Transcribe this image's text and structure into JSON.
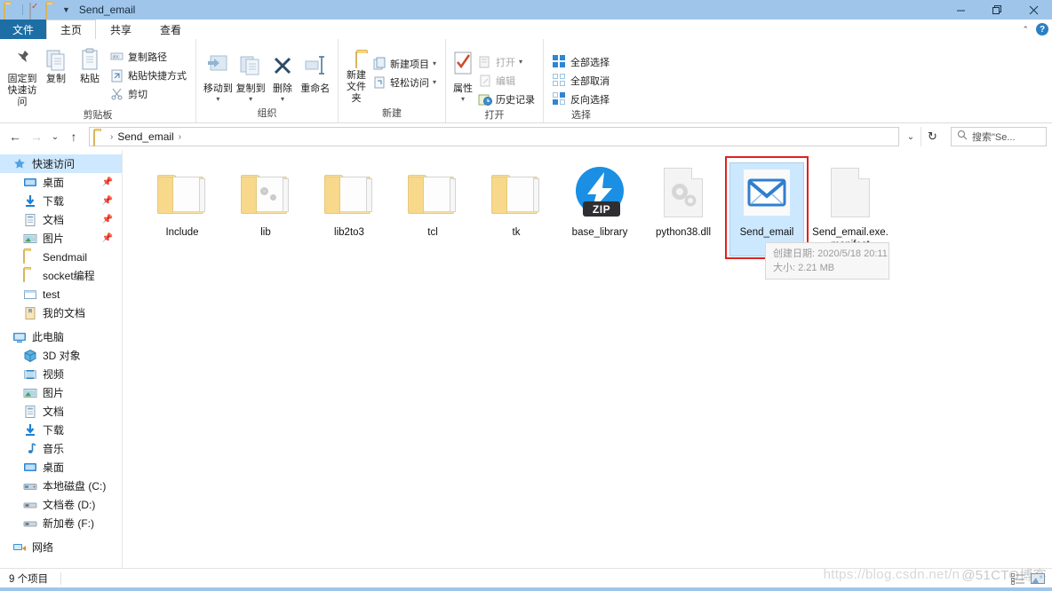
{
  "window": {
    "title": "Send_email",
    "quick_access": [
      "folder-icon",
      "properties-icon",
      "folder-icon",
      "dropdown-icon"
    ],
    "controls": {
      "minimize": "—",
      "maximize": "❐",
      "close": "✕"
    }
  },
  "menubar": {
    "file_tab": "文件",
    "tabs": [
      {
        "label": "主页",
        "active": true
      },
      {
        "label": "共享",
        "active": false
      },
      {
        "label": "查看",
        "active": false
      }
    ],
    "collapse": "⌃",
    "help": "?"
  },
  "ribbon": {
    "groups": [
      {
        "title": "剪贴板",
        "big_buttons": [
          {
            "label": "固定到快速访问",
            "icon": "pin-icon"
          },
          {
            "label": "复制",
            "icon": "copy-icon"
          },
          {
            "label": "粘贴",
            "icon": "paste-icon"
          }
        ],
        "small_buttons": [
          {
            "label": "复制路径",
            "icon": "copy-path-icon"
          },
          {
            "label": "粘贴快捷方式",
            "icon": "paste-shortcut-icon"
          },
          {
            "label": "剪切",
            "icon": "scissors-icon"
          }
        ]
      },
      {
        "title": "组织",
        "big_buttons": [
          {
            "label": "移动到",
            "icon": "move-to-icon"
          },
          {
            "label": "复制到",
            "icon": "copy-to-icon"
          },
          {
            "label": "删除",
            "icon": "delete-x-icon"
          },
          {
            "label": "重命名",
            "icon": "rename-icon"
          }
        ]
      },
      {
        "title": "新建",
        "big_buttons": [
          {
            "label": "新建文件夹",
            "icon": "new-folder-icon"
          }
        ],
        "small_buttons": [
          {
            "label": "新建项目",
            "icon": "new-item-icon"
          },
          {
            "label": "轻松访问",
            "icon": "easy-access-icon"
          }
        ]
      },
      {
        "title": "打开",
        "big_buttons": [
          {
            "label": "属性",
            "icon": "properties-icon"
          }
        ],
        "small_buttons": [
          {
            "label": "打开",
            "icon": "open-icon"
          },
          {
            "label": "编辑",
            "icon": "edit-icon"
          },
          {
            "label": "历史记录",
            "icon": "history-icon"
          }
        ]
      },
      {
        "title": "选择",
        "small_buttons": [
          {
            "label": "全部选择",
            "icon": "select-all-icon"
          },
          {
            "label": "全部取消",
            "icon": "select-none-icon"
          },
          {
            "label": "反向选择",
            "icon": "invert-selection-icon"
          }
        ]
      }
    ]
  },
  "addressbar": {
    "back": "←",
    "forward": "→",
    "history": "⌄",
    "up": "↑",
    "breadcrumbs": [
      "Send_email"
    ],
    "dropdown": "⌄",
    "refresh": "↻",
    "search_placeholder": "搜索\"Se..."
  },
  "sidebar": {
    "groups": [
      {
        "header": {
          "label": "快速访问",
          "icon": "star-pin-icon",
          "selected": true
        },
        "items": [
          {
            "label": "桌面",
            "icon": "desktop-icon",
            "pinned": true
          },
          {
            "label": "下载",
            "icon": "download-icon",
            "pinned": true
          },
          {
            "label": "文档",
            "icon": "documents-icon",
            "pinned": true
          },
          {
            "label": "图片",
            "icon": "pictures-icon",
            "pinned": true
          },
          {
            "label": "Sendmail",
            "icon": "folder-icon",
            "pinned": false
          },
          {
            "label": "socket编程",
            "icon": "folder-icon",
            "pinned": false
          },
          {
            "label": "test",
            "icon": "window-icon",
            "pinned": false
          },
          {
            "label": "我的文档",
            "icon": "my-documents-icon",
            "pinned": false
          }
        ]
      },
      {
        "header": {
          "label": "此电脑",
          "icon": "this-pc-icon",
          "selected": false
        },
        "items": [
          {
            "label": "3D 对象",
            "icon": "3d-objects-icon",
            "pinned": false
          },
          {
            "label": "视频",
            "icon": "videos-icon",
            "pinned": false
          },
          {
            "label": "图片",
            "icon": "pictures-icon",
            "pinned": false
          },
          {
            "label": "文档",
            "icon": "documents-icon",
            "pinned": false
          },
          {
            "label": "下载",
            "icon": "download-icon",
            "pinned": false
          },
          {
            "label": "音乐",
            "icon": "music-icon",
            "pinned": false
          },
          {
            "label": "桌面",
            "icon": "desktop-icon",
            "pinned": false
          },
          {
            "label": "本地磁盘 (C:)",
            "icon": "system-drive-icon",
            "pinned": false
          },
          {
            "label": "文档卷 (D:)",
            "icon": "drive-icon",
            "pinned": false
          },
          {
            "label": "新加卷 (F:)",
            "icon": "drive-icon",
            "pinned": false
          }
        ]
      },
      {
        "header": {
          "label": "网络",
          "icon": "network-icon",
          "selected": false
        },
        "items": []
      }
    ]
  },
  "files": [
    {
      "name": "Include",
      "type": "folder",
      "selected": false
    },
    {
      "name": "lib",
      "type": "folder-gears",
      "selected": false
    },
    {
      "name": "lib2to3",
      "type": "folder",
      "selected": false
    },
    {
      "name": "tcl",
      "type": "folder",
      "selected": false
    },
    {
      "name": "tk",
      "type": "folder",
      "selected": false
    },
    {
      "name": "base_library",
      "type": "zip",
      "selected": false,
      "zip_label": "ZIP"
    },
    {
      "name": "python38.dll",
      "type": "dll",
      "selected": false
    },
    {
      "name": "Send_email",
      "type": "mail-app",
      "selected": true
    },
    {
      "name": "Send_email.exe.manifest",
      "type": "manifest",
      "selected": false
    }
  ],
  "tooltip": {
    "line1": "创建日期: 2020/5/18 20:11",
    "line2": "大小: 2.21 MB"
  },
  "watermark": {
    "url": "https://blog.csdn.net/n",
    "tag": "@51CTO博客"
  },
  "statusbar": {
    "item_count": "9 个项目",
    "view_large": "large-icons-view-icon",
    "view_details": "details-view-icon"
  }
}
